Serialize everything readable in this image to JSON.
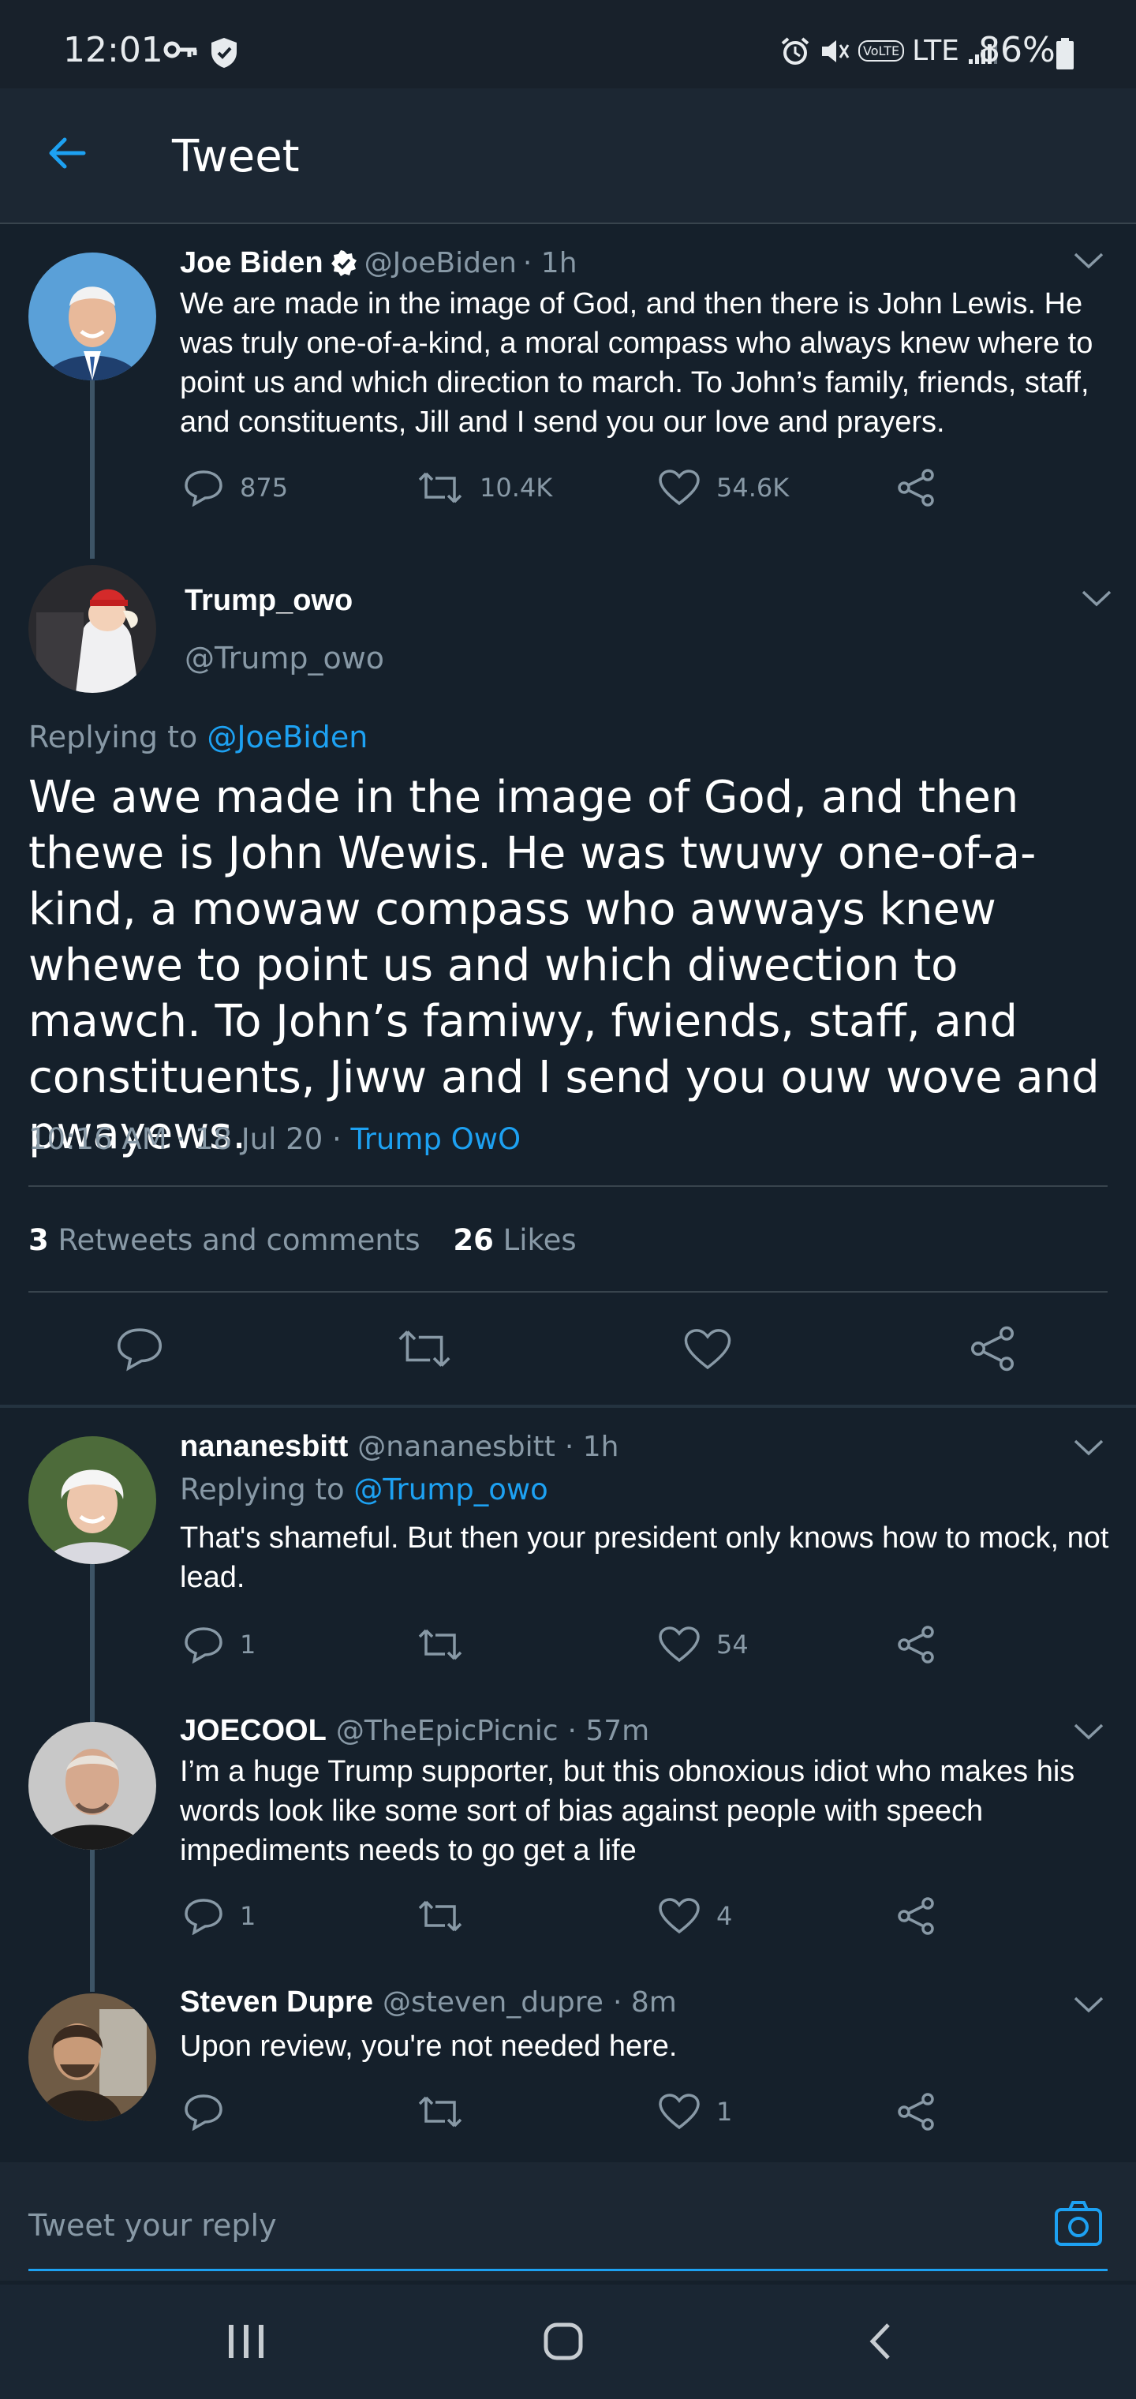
{
  "status_bar": {
    "time": "12:01",
    "network": "LTE",
    "volte": "VoLTE",
    "battery": "86%"
  },
  "header": {
    "title": "Tweet"
  },
  "parent_tweet": {
    "name": "Joe Biden",
    "handle": "@JoeBiden",
    "time": "· 1h",
    "text": "We are made in the image of God, and then there is John Lewis. He was truly one-of-a-kind, a moral compass who always knew where to point us and which direction to march. To John’s family, friends, staff, and constituents, Jill and I send you our love and prayers.",
    "replies": "875",
    "retweets": "10.4K",
    "likes": "54.6K"
  },
  "main_tweet": {
    "name": "Trump_owo",
    "handle": "@Trump_owo",
    "replying_prefix": "Replying to",
    "replying_to": "@JoeBiden",
    "text": "We awe made in the image of God, and then thewe is John Wewis. He was twuwy one-of-a-kind, a mowaw compass who awways knew whewe to point us and which diwection to mawch. To John’s famiwy, fwiends, staff, and constituents, Jiww and I send you ouw wove and pwayews.",
    "timestamp": "10:16 AM · 18 Jul 20 ·",
    "source": "Trump OwO",
    "retweet_count": "3",
    "retweet_label": "Retweets and comments",
    "like_count": "26",
    "like_label": "Likes"
  },
  "replies": [
    {
      "name": "nananesbitt",
      "handle": "@nananesbitt",
      "time": "· 1h",
      "replying_prefix": "Replying to",
      "replying_to": "@Trump_owo",
      "text": "That's shameful. But then your president only knows how to mock, not lead.",
      "replies": "1",
      "retweets": "",
      "likes": "54"
    },
    {
      "name": "JOECOOL",
      "handle": "@TheEpicPicnic",
      "time": "· 57m",
      "text": "I’m a huge Trump supporter, but this obnoxious idiot who makes his words look like some sort of bias against people with speech impediments needs to go get a life",
      "replies": "1",
      "retweets": "",
      "likes": "4"
    },
    {
      "name": "Steven Dupre",
      "handle": "@steven_dupre",
      "time": "· 8m",
      "text": "Upon review, you're not needed here.",
      "replies": "",
      "retweets": "",
      "likes": "1"
    }
  ],
  "reply_box": {
    "placeholder": "Tweet your reply"
  },
  "colors": {
    "background": "#15202b",
    "accent": "#1da1f2",
    "muted": "#8899a6",
    "divider": "#38444d"
  },
  "icons": [
    "key-icon",
    "shield-icon",
    "alarm-icon",
    "mute-icon",
    "wifi-calling-icon",
    "signal-icon",
    "battery-icon",
    "back-arrow-icon",
    "verified-badge-icon",
    "chevron-down-icon",
    "reply-icon",
    "retweet-icon",
    "like-icon",
    "share-icon",
    "camera-icon",
    "recent-apps-icon",
    "home-icon",
    "nav-back-icon"
  ]
}
